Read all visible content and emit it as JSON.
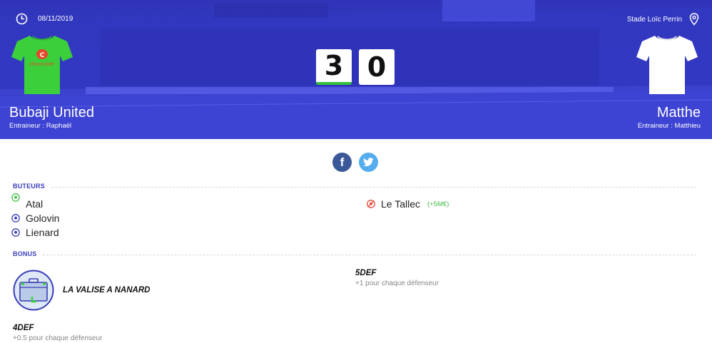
{
  "match": {
    "date": "08/11/2019",
    "venue": "Stade Loïc Perrin",
    "home": {
      "name": "Bubaji United",
      "coach": "Entraineur : Raphaël",
      "score": "3",
      "jersey_color": "#3ccf3c",
      "jersey_sponsor": "charcutier"
    },
    "away": {
      "name": "Matthe",
      "coach": "Entraineur : Matthieu",
      "score": "0",
      "jersey_color": "#ffffff"
    },
    "winner_accent": "#36c23f",
    "header_tint": "#3a3fd0"
  },
  "social": {
    "facebook_icon": "facebook-icon",
    "twitter_icon": "twitter-icon"
  },
  "scorers": {
    "title": "BUTEURS",
    "home": [
      {
        "name": "Atal",
        "icon": "ball-green-icon"
      },
      {
        "name": "Golovin",
        "icon": "ball-blue-icon"
      },
      {
        "name": "Lienard",
        "icon": "ball-blue-icon"
      }
    ],
    "away": [
      {
        "name": "Le Tallec",
        "bonus": "(+5M€)",
        "icon": "ball-red-icon"
      }
    ]
  },
  "bonus": {
    "title": "BONUS",
    "home_items": [
      {
        "name": "LA VALISE A NANARD",
        "icon": "suitcase-icon"
      },
      {
        "code": "4DEF",
        "desc": "+0.5 pour chaque défenseur"
      }
    ],
    "away_items": [
      {
        "code": "5DEF",
        "desc": "+1 pour chaque défenseur"
      }
    ]
  }
}
